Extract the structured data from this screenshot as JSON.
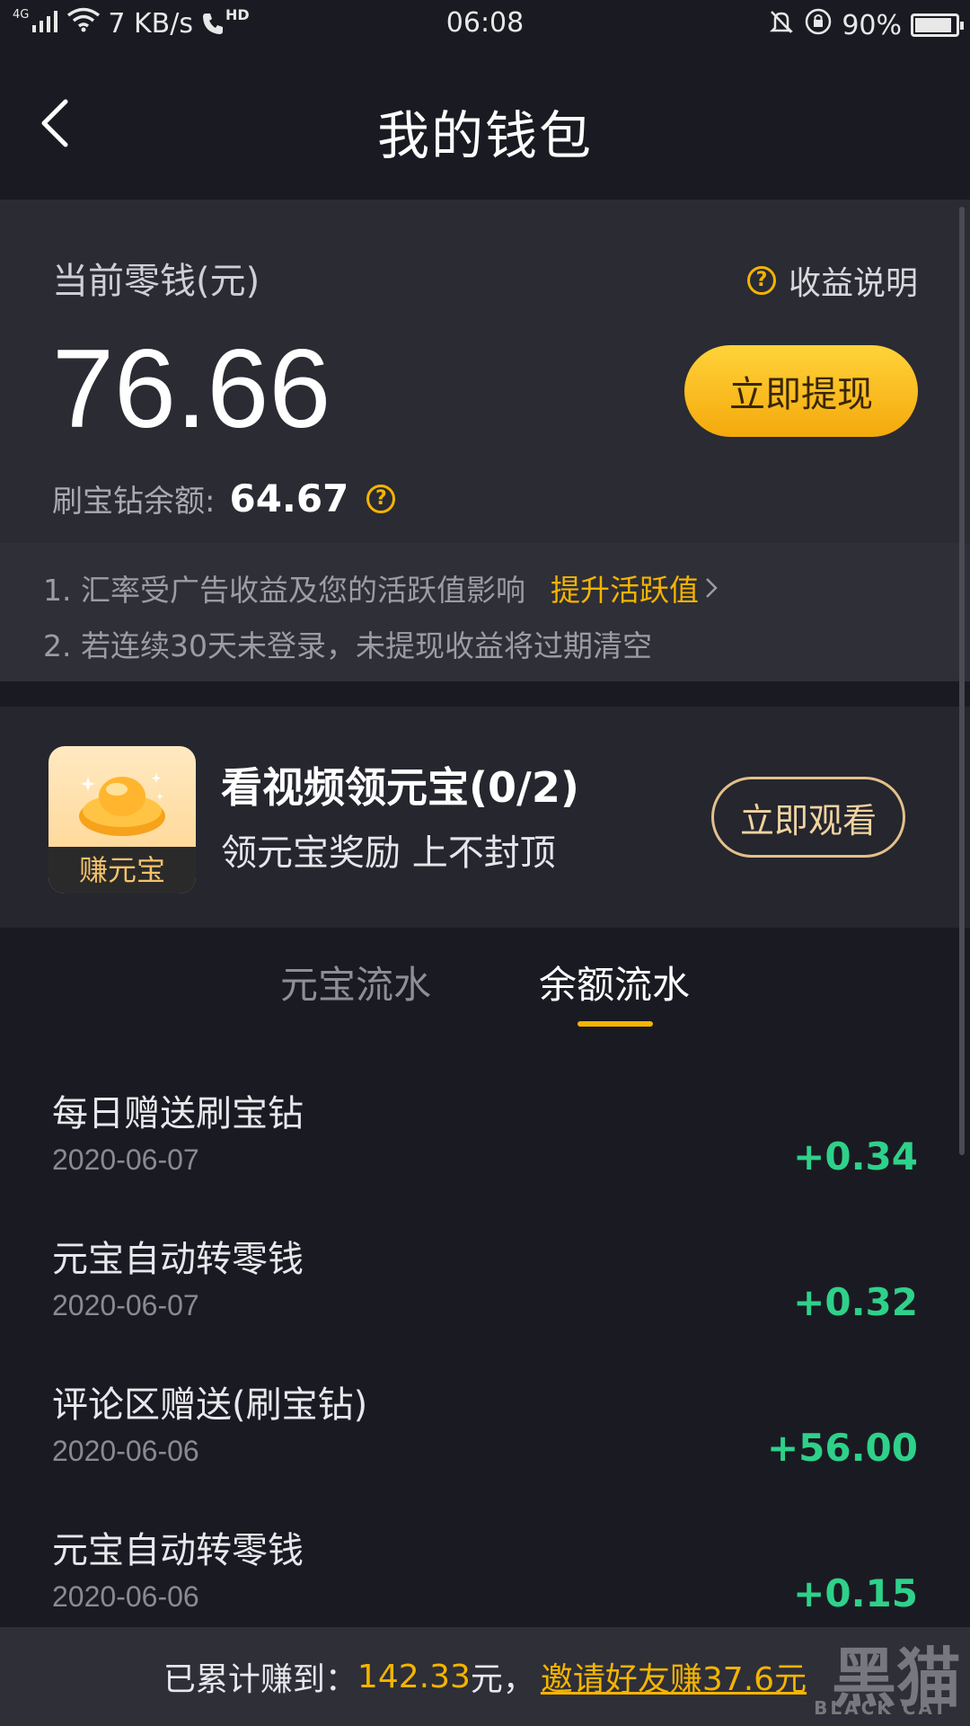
{
  "status_bar": {
    "network_tag": "4G",
    "speed": "7 KB/s",
    "hd_tag": "HD",
    "time": "06:08",
    "battery": "90%",
    "battery_level": 0.9
  },
  "nav": {
    "title": "我的钱包"
  },
  "wallet": {
    "balance_label": "当前零钱(元)",
    "income_link": "收益说明",
    "balance": "76.66",
    "withdraw_label": "立即提现",
    "diamond_label": "刷宝钻余额:",
    "diamond_value": "64.67"
  },
  "notes": {
    "note1": "1. 汇率受广告收益及您的活跃值影响",
    "note1_link": "提升活跃值",
    "note2": "2. 若连续30天未登录，未提现收益将过期清空"
  },
  "task": {
    "icon_label": "赚元宝",
    "title": "看视频领元宝(0/2)",
    "subtitle": "领元宝奖励 上不封顶",
    "button": "立即观看"
  },
  "tabs": [
    {
      "label": "元宝流水",
      "active": false
    },
    {
      "label": "余额流水",
      "active": true
    }
  ],
  "records": [
    {
      "title": "每日赠送刷宝钻",
      "date": "2020-06-07",
      "amount": "+0.34"
    },
    {
      "title": "元宝自动转零钱",
      "date": "2020-06-07",
      "amount": "+0.32"
    },
    {
      "title": "评论区赠送(刷宝钻)",
      "date": "2020-06-06",
      "amount": "+56.00"
    },
    {
      "title": "元宝自动转零钱",
      "date": "2020-06-06",
      "amount": "+0.15"
    }
  ],
  "footer": {
    "prefix": "已累计赚到：",
    "amount": "142.33",
    "suffix": "元，",
    "invite": "邀请好友赚37.6元"
  },
  "watermark": {
    "text": "黑猫",
    "sub": "BLACK CAT"
  },
  "colors": {
    "accent": "#f5b400",
    "positive": "#2ed18a",
    "background": "#1a1b22",
    "card": "#2a2b33"
  }
}
